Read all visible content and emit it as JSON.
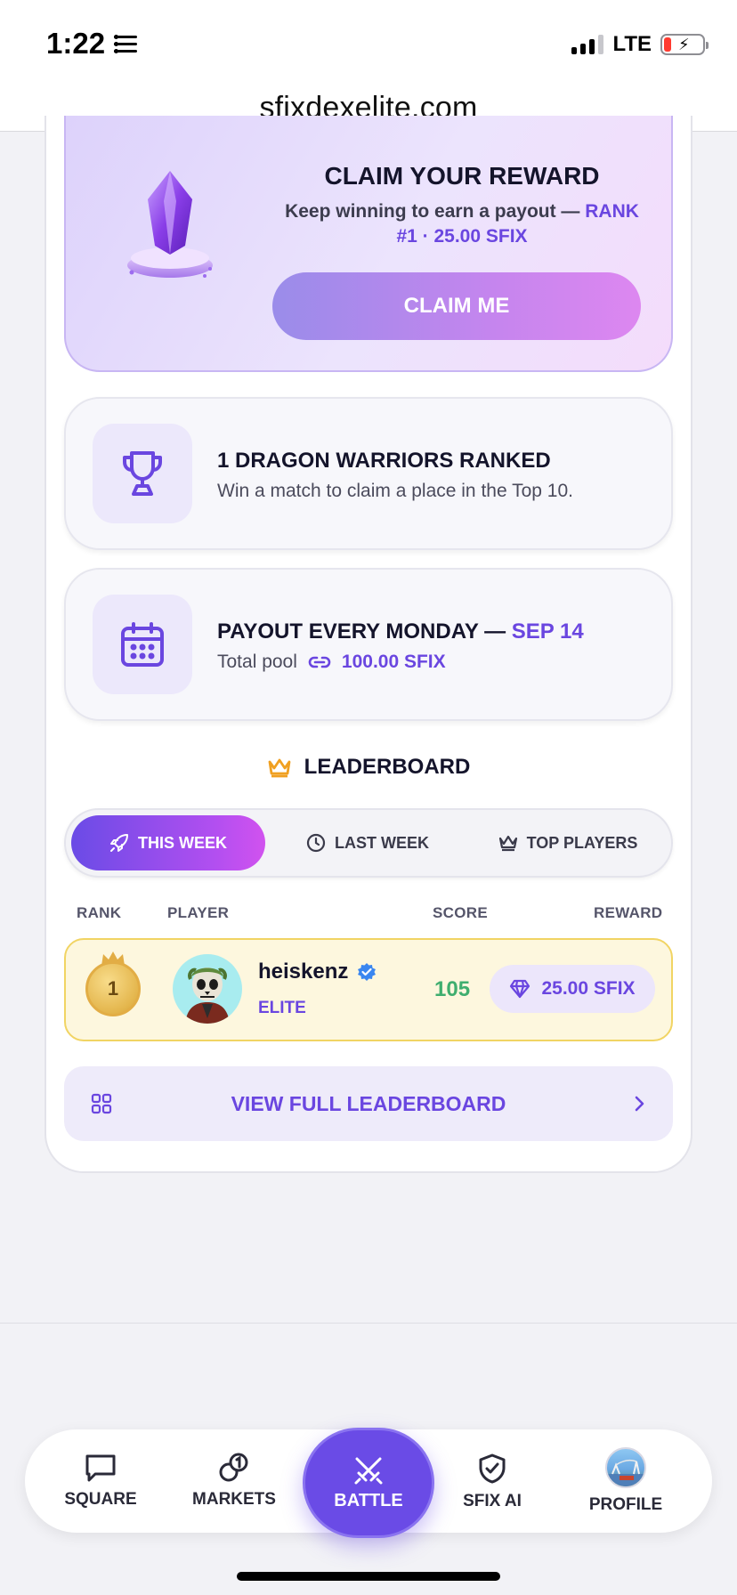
{
  "status_bar": {
    "time": "1:22",
    "network": "LTE"
  },
  "browser": {
    "url": "sfixdexelite.com"
  },
  "claim": {
    "title": "CLAIM YOUR REWARD",
    "subtitle_main": "Keep winning to earn a payout — ",
    "subtitle_accent": "RANK #1 · 25.00 SFIX",
    "button_label": "CLAIM ME"
  },
  "ranked_card": {
    "icon": "trophy-icon",
    "title": "1 DRAGON WARRIORS RANKED",
    "subtitle": "Win a match to claim a place in the Top 10."
  },
  "payout_card": {
    "icon": "calendar-icon",
    "title_main": "PAYOUT EVERY MONDAY — ",
    "title_accent": "SEP 14",
    "pool_label": "Total pool",
    "pool_value": "100.00 SFIX"
  },
  "leaderboard": {
    "heading": "LEADERBOARD",
    "tabs": [
      {
        "label": "THIS WEEK",
        "icon": "rocket-icon",
        "active": true
      },
      {
        "label": "LAST WEEK",
        "icon": "clock-icon",
        "active": false
      },
      {
        "label": "TOP PLAYERS",
        "icon": "crown-icon",
        "active": false
      }
    ],
    "columns": {
      "rank": "RANK",
      "player": "PLAYER",
      "score": "SCORE",
      "reward": "REWARD"
    },
    "rows": [
      {
        "rank": "1",
        "name": "heiskenz",
        "verified": true,
        "tier": "ELITE",
        "score": "105",
        "reward": "25.00 SFIX"
      }
    ],
    "view_full_label": "VIEW FULL LEADERBOARD"
  },
  "bottom_nav": {
    "items": [
      {
        "label": "SQUARE",
        "icon": "chat-icon"
      },
      {
        "label": "MARKETS",
        "icon": "coins-icon"
      },
      {
        "label": "BATTLE",
        "icon": "swords-icon",
        "active": true
      },
      {
        "label": "SFIX AI",
        "icon": "shield-icon"
      },
      {
        "label": "PROFILE",
        "icon": "avatar"
      }
    ]
  },
  "colors": {
    "accent": "#6a46e0",
    "score_green": "#3fae6f",
    "gold_border": "#f1d463"
  }
}
